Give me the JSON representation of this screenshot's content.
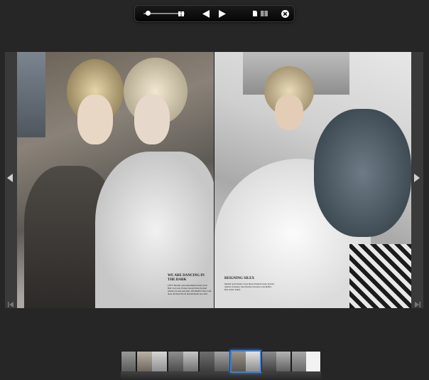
{
  "toolbar": {
    "zoom_value": 0.1,
    "icons": [
      "zoom-slider",
      "single-page-view-icon",
      "previous-page-icon",
      "next-page-icon",
      "thumbnail-view-icon",
      "double-page-view-icon",
      "close-icon"
    ]
  },
  "viewer": {
    "left_page_caption": {
      "heading": "WE ARE DANCING IN THE DARK",
      "body": "LEFT: Metallic gold embellished bustier, Kate Hall; Lucy mac bronze bracelet dress; Ronald Abdala brocade satin skirt. ON RIGHT: Silver tulle dress, Richard Nicoll; Kendall Ruins lace skirt."
    },
    "right_page_caption": {
      "heading": "REIGNING SILEX",
      "body": "Metallic gold bustier, Jewel Heels; Diamond skirt, Ronald Abdala; Jewellery, Jane Parrish; bracelets, Lida Maffei. Hair stylist: Kuma."
    }
  },
  "thumbnails": {
    "count": 7,
    "active_index": 4
  },
  "colors": {
    "background": "#262626",
    "toolbar": "#0a0a0a",
    "viewer": "#3a3a3a",
    "active_thumb": "#3f7ecf"
  }
}
